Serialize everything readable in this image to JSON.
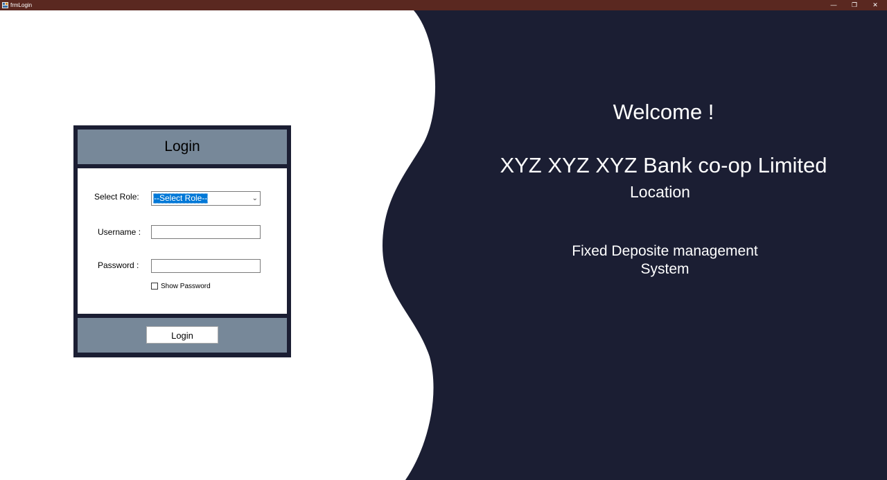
{
  "window": {
    "title": "frmLogin",
    "minimize_glyph": "—",
    "restore_glyph": "❐",
    "close_glyph": "✕"
  },
  "colors": {
    "titlebar": "#5a2820",
    "dark_panel": "#1b1e33",
    "panel_accent": "#778899",
    "selection": "#0078d7"
  },
  "login_form": {
    "header": "Login",
    "role_label": "Select Role:",
    "role_selected": "--Select Role--",
    "username_label": "Username :",
    "username_value": "",
    "password_label": "Password :",
    "password_value": "",
    "show_password_label": "Show Password",
    "show_password_checked": false,
    "submit_label": "Login"
  },
  "welcome_panel": {
    "greeting": "Welcome !",
    "bank_name": "XYZ XYZ XYZ Bank co-op Limited",
    "location": "Location",
    "system_line1": "Fixed Deposite management",
    "system_line2": "System"
  }
}
